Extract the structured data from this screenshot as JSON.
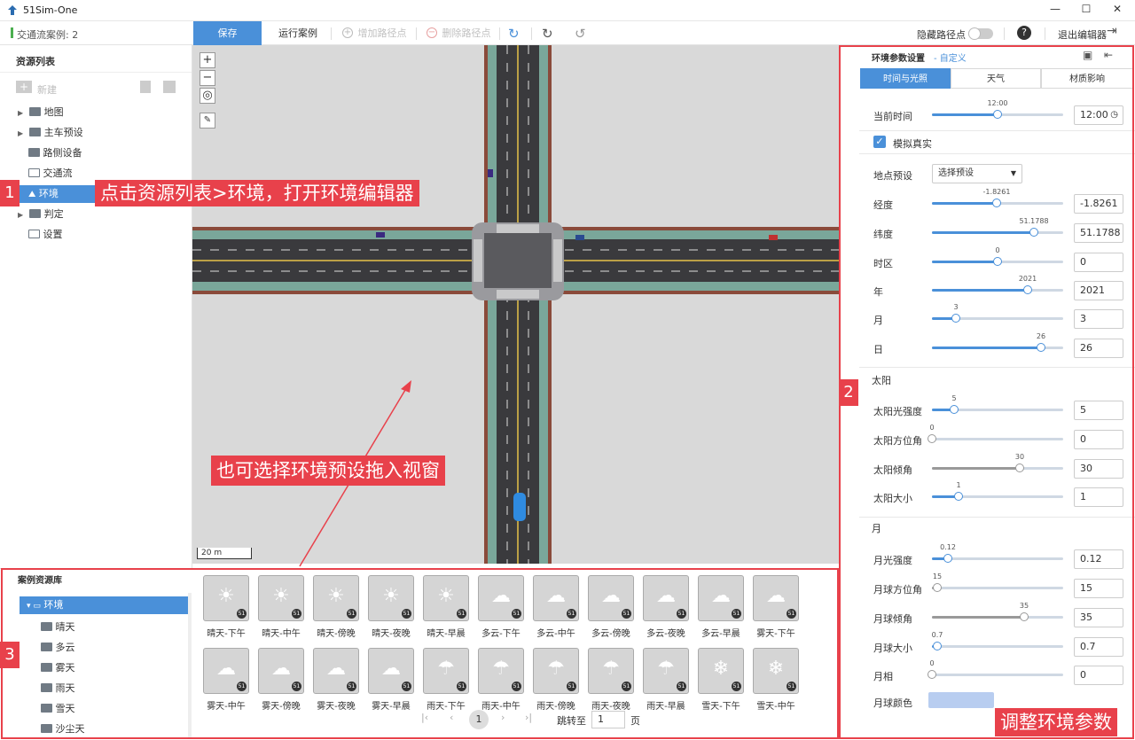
{
  "app": {
    "title": "51Sim-One"
  },
  "status": {
    "traffic_cases": "交通流案例: 2"
  },
  "toolbar": {
    "save": "保存",
    "run_case": "运行案例",
    "add_waypoint": "增加路径点",
    "delete_waypoint": "删除路径点",
    "hide_waypoints": "隐藏路径点",
    "exit_editor": "退出编辑器"
  },
  "resource_list": {
    "title": "资源列表",
    "new": "新建",
    "items": [
      "地图",
      "主车预设",
      "路侧设备",
      "交通流",
      "环境",
      "判定",
      "设置"
    ]
  },
  "map": {
    "scale": "20 m"
  },
  "env_panel": {
    "title": "环境参数设置",
    "mode": "- 自定义",
    "tabs": [
      "时间与光照",
      "天气",
      "材质影响"
    ],
    "current_time_label": "当前时间",
    "current_time_value": "12:00",
    "current_time_slider": "12:00",
    "simulate_real": "模拟真实",
    "location_preset_label": "地点预设",
    "location_preset_value": "选择预设",
    "params": [
      {
        "label": "经度",
        "value": "-1.8261",
        "slider": "-1.8261",
        "fraction": 0.49
      },
      {
        "label": "纬度",
        "value": "51.1788",
        "slider": "51.1788",
        "fraction": 0.78
      },
      {
        "label": "时区",
        "value": "0",
        "slider": "0",
        "fraction": 0.5
      },
      {
        "label": "年",
        "value": "2021",
        "slider": "2021",
        "fraction": 0.73
      },
      {
        "label": "月",
        "value": "3",
        "slider": "3",
        "fraction": 0.18
      },
      {
        "label": "日",
        "value": "26",
        "slider": "26",
        "fraction": 0.83
      }
    ],
    "sun_title": "太阳",
    "sun": [
      {
        "label": "太阳光强度",
        "value": "5",
        "slider": "5",
        "fraction": 0.17
      },
      {
        "label": "太阳方位角",
        "value": "0",
        "slider": "0",
        "fraction": 0.0
      },
      {
        "label": "太阳倾角",
        "value": "30",
        "slider": "30",
        "fraction": 0.67
      },
      {
        "label": "太阳大小",
        "value": "1",
        "slider": "1",
        "fraction": 0.2
      }
    ],
    "moon_title": "月",
    "moon": [
      {
        "label": "月光强度",
        "value": "0.12",
        "slider": "0.12",
        "fraction": 0.12
      },
      {
        "label": "月球方位角",
        "value": "15",
        "slider": "15",
        "fraction": 0.04
      },
      {
        "label": "月球倾角",
        "value": "35",
        "slider": "35",
        "fraction": 0.7
      },
      {
        "label": "月球大小",
        "value": "0.7",
        "slider": "0.7",
        "fraction": 0.04
      },
      {
        "label": "月相",
        "value": "0",
        "slider": "0",
        "fraction": 0.0
      }
    ],
    "moon_color_label": "月球颜色",
    "moon_color": "#b8cdf0"
  },
  "library": {
    "title": "案例资源库",
    "root": "环境",
    "items": [
      "晴天",
      "多云",
      "雾天",
      "雨天",
      "雪天",
      "沙尘天"
    ]
  },
  "presets_row1": [
    "晴天-下午",
    "晴天-中午",
    "晴天-傍晚",
    "晴天-夜晚",
    "晴天-早晨",
    "多云-下午",
    "多云-中午",
    "多云-傍晚",
    "多云-夜晚",
    "多云-早晨",
    "雾天-下午"
  ],
  "presets_row2": [
    "雾天-中午",
    "雾天-傍晚",
    "雾天-夜晚",
    "雾天-早晨",
    "雨天-下午",
    "雨天-中午",
    "雨天-傍晚",
    "雨天-夜晚",
    "雨天-早晨",
    "雪天-下午",
    "雪天-中午"
  ],
  "pagination": {
    "page": "1",
    "jump_label": "跳转至",
    "jump_value": "1",
    "page_unit": "页"
  },
  "annotations": {
    "n1": "1",
    "n2": "2",
    "n3": "3",
    "callout1": "点击资源列表>环境，打开环境编辑器",
    "callout2": "也可选择环境预设拖入视窗",
    "callout3": "调整环境参数"
  },
  "colors": {
    "accent": "#4a90d9",
    "annotation": "#e8414b",
    "selected": "#4a90d9"
  }
}
